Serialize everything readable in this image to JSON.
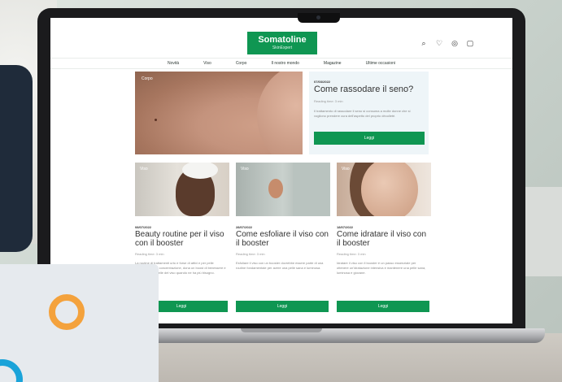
{
  "brand": {
    "name": "Somatoline",
    "tagline": "SkinExpert",
    "accent": "#0f9652"
  },
  "header_icons": [
    "search-icon",
    "heart-icon",
    "user-icon",
    "bag-icon"
  ],
  "nav": [
    "Novità",
    "Viso",
    "Corpo",
    "Il nostro mondo",
    "Magazine",
    "Ultime occasioni"
  ],
  "hero": {
    "tag": "Corpo",
    "date": "07/03/2022",
    "title": "Come rassodare il seno?",
    "meta": "Reading time: 3 min",
    "description": "Il trattamento di rassodare il seno si consuma a molte donne che si vogliono prendere cura dell'aspetto del proprio décolleté.",
    "button": "Leggi"
  },
  "cards": [
    {
      "tag": "Viso",
      "date": "08/07/2022",
      "title": "Beauty routine per il viso con il booster",
      "meta": "Reading time: 3 min",
      "description": "La routine di trattamenti urto e forse di attivi e per pelle sensibili, ad alta concentrazione, dona un boost di benessere e luminosità alla pelle del viso quando ne ha più bisogno.",
      "button": "Leggi"
    },
    {
      "tag": "Viso",
      "date": "28/07/2022",
      "title": "Come esfoliare il viso con il booster",
      "meta": "Reading time: 3 min",
      "description": "Esfoliare il viso con un booster dovrebbe essere parte di una routine fondamentale per avere una pelle sana e luminosa.",
      "button": "Leggi"
    },
    {
      "tag": "Viso",
      "date": "18/07/2022",
      "title": "Come idratare il viso con il booster",
      "meta": "Reading time: 3 min",
      "description": "Idratare il viso con il booster è un passo essenziale per ottenere un'idratazione intensiva e mantenere una pelle sana, luminosa e giovane.",
      "button": "Leggi"
    }
  ],
  "colors": {
    "ring_orange": "#f4a23c",
    "ring_blue": "#1aa3d9",
    "hero_panel": "#eef5f8"
  }
}
